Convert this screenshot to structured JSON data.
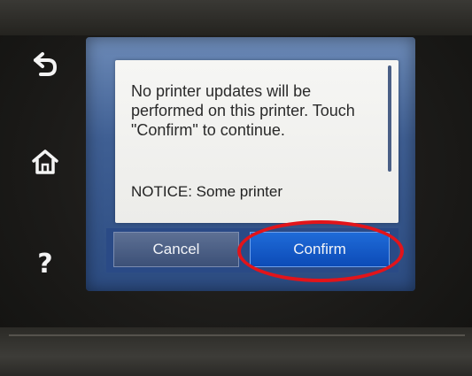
{
  "device": {
    "side_buttons": [
      {
        "name": "back",
        "icon": "back-arrow-icon"
      },
      {
        "name": "home",
        "icon": "home-icon"
      },
      {
        "name": "help",
        "icon": "help-icon",
        "glyph": "?"
      }
    ]
  },
  "dialog": {
    "message": "No printer updates will be performed on this printer. Touch \"Confirm\" to continue.",
    "notice": "NOTICE: Some printer",
    "buttons": {
      "cancel_label": "Cancel",
      "confirm_label": "Confirm"
    }
  },
  "annotation": {
    "highlight_color": "#e2141a",
    "highlight_target": "confirm-button"
  },
  "colors": {
    "confirm_button": "#1f6bd8",
    "cancel_button": "#5d7094",
    "dialog_background": "#f6f6f4"
  }
}
